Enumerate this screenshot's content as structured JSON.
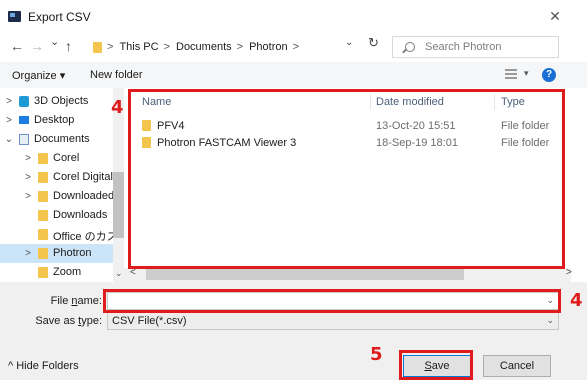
{
  "window": {
    "title": "Export CSV",
    "close_glyph": "✕"
  },
  "nav": {
    "back_glyph": "←",
    "forward_glyph": "→",
    "recent_glyph": "⌄",
    "up_glyph": "↑",
    "breadcrumbs": [
      "This PC",
      "Documents",
      "Photron"
    ],
    "crumb_separator": ">",
    "address_dropdown_glyph": "⌄",
    "refresh_glyph": "↻",
    "search_placeholder": "Search Photron"
  },
  "toolbar": {
    "organize_label": "Organize ▾",
    "new_folder_label": "New folder",
    "view_dropdown_glyph": "▾",
    "help_glyph": "?"
  },
  "sidebar": {
    "items": [
      {
        "label": "3D Objects",
        "icon": "3d-objects-icon",
        "chevron": ">"
      },
      {
        "label": "Desktop",
        "icon": "desktop-icon",
        "chevron": ">"
      },
      {
        "label": "Documents",
        "icon": "documents-icon",
        "chevron": "⌄"
      },
      {
        "label": "Corel",
        "icon": "folder-icon",
        "chevron": ">"
      },
      {
        "label": "Corel Digital S",
        "icon": "folder-icon",
        "chevron": ">"
      },
      {
        "label": "Downloaded",
        "icon": "folder-icon",
        "chevron": ">"
      },
      {
        "label": "Downloads",
        "icon": "folder-icon",
        "chevron": ""
      },
      {
        "label": "Office のカスタ",
        "icon": "folder-icon",
        "chevron": ""
      },
      {
        "label": "Photron",
        "icon": "folder-icon",
        "chevron": ">",
        "selected": true
      },
      {
        "label": "Zoom",
        "icon": "folder-icon",
        "chevron": ""
      }
    ],
    "scroll_down_glyph": "⌄"
  },
  "file_list": {
    "columns": [
      "Name",
      "Date modified",
      "Type"
    ],
    "rows": [
      {
        "name": "PFV4",
        "date": "13-Oct-20 15:51",
        "type": "File folder"
      },
      {
        "name": "Photron FASTCAM Viewer 3",
        "date": "18-Sep-19 18:01",
        "type": "File folder"
      }
    ],
    "scroll_left_glyph": "<",
    "scroll_right_glyph": ">"
  },
  "form": {
    "file_name_label_pre": "File ",
    "file_name_label_u": "n",
    "file_name_label_post": "ame:",
    "file_name_value": "",
    "file_name_dropdown_glyph": "⌄",
    "save_type_label_pre": "Save as ",
    "save_type_label_u": "t",
    "save_type_label_post": "ype:",
    "save_type_value": "CSV File(*.csv)",
    "save_type_dropdown_glyph": "⌄"
  },
  "footer": {
    "hide_folders_label": "^ Hide Folders",
    "save_label_u": "S",
    "save_label_post": "ave",
    "cancel_label": "Cancel"
  },
  "annotations": {
    "callout_list_number": "4",
    "callout_filename_number": "4",
    "callout_save_number": "5",
    "callout_color": "#e01b1b"
  }
}
